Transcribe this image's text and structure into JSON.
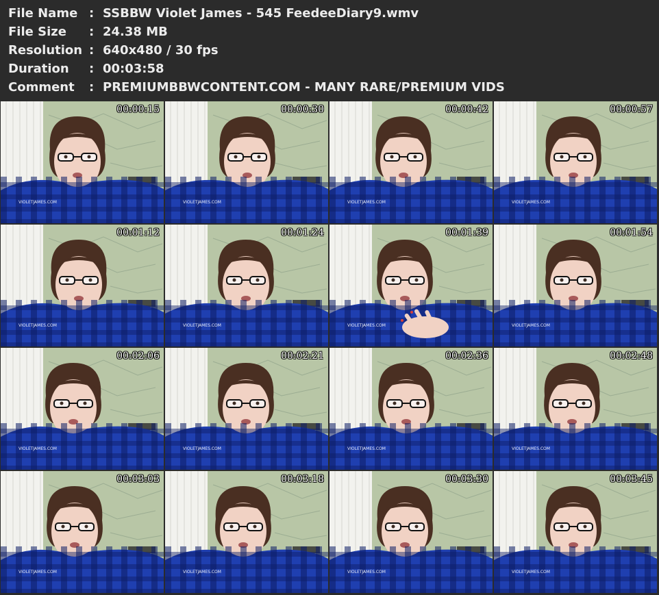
{
  "info": {
    "file_name_label": "File Name",
    "file_name": "SSBBW Violet James - 545 FeedeeDiary9.wmv",
    "file_size_label": "File Size",
    "file_size": "24.38 MB",
    "resolution_label": "Resolution",
    "resolution": "640x480 / 30 fps",
    "duration_label": "Duration",
    "duration": "00:03:58",
    "comment_label": "Comment",
    "comment": "PREMIUMBBWCONTENT.COM - MANY RARE/PREMIUM VIDS",
    "separator": ":"
  },
  "thumbnails": [
    {
      "timestamp": "00:00:15",
      "watermark": "VIOLETJAMES.COM",
      "hands": false
    },
    {
      "timestamp": "00:00:30",
      "watermark": "VIOLETJAMES.COM",
      "hands": false
    },
    {
      "timestamp": "00:00:42",
      "watermark": "VIOLETJAMES.COM",
      "hands": false
    },
    {
      "timestamp": "00:00:57",
      "watermark": "VIOLETJAMES.COM",
      "hands": false
    },
    {
      "timestamp": "00:01:12",
      "watermark": "VIOLETJAMES.COM",
      "hands": false
    },
    {
      "timestamp": "00:01:24",
      "watermark": "VIOLETJAMES.COM",
      "hands": false
    },
    {
      "timestamp": "00:01:39",
      "watermark": "VIOLETJAMES.COM",
      "hands": true
    },
    {
      "timestamp": "00:01:54",
      "watermark": "VIOLETJAMES.COM",
      "hands": false
    },
    {
      "timestamp": "00:02:06",
      "watermark": "VIOLETJAMES.COM",
      "hands": false
    },
    {
      "timestamp": "00:02:21",
      "watermark": "VIOLETJAMES.COM",
      "hands": false
    },
    {
      "timestamp": "00:02:36",
      "watermark": "VIOLETJAMES.COM",
      "hands": false
    },
    {
      "timestamp": "00:02:48",
      "watermark": "VIOLETJAMES.COM",
      "hands": false
    },
    {
      "timestamp": "00:03:03",
      "watermark": "VIOLETJAMES.COM",
      "hands": false
    },
    {
      "timestamp": "00:03:18",
      "watermark": "VIOLETJAMES.COM",
      "hands": false
    },
    {
      "timestamp": "00:03:30",
      "watermark": "VIOLETJAMES.COM",
      "hands": false
    },
    {
      "timestamp": "00:03:45",
      "watermark": "VIOLETJAMES.COM",
      "hands": false
    }
  ],
  "colors": {
    "background": "#2b2b2b",
    "header_text": "#ececec",
    "timestamp_text": "#ffffff",
    "shirt_blue": "#1f3fb0",
    "shirt_dark": "#0d1d66",
    "skin": "#f1d2c4",
    "hair": "#4a2f22",
    "wall_map": "#b8c6a6",
    "blinds": "#f2f2ee"
  }
}
